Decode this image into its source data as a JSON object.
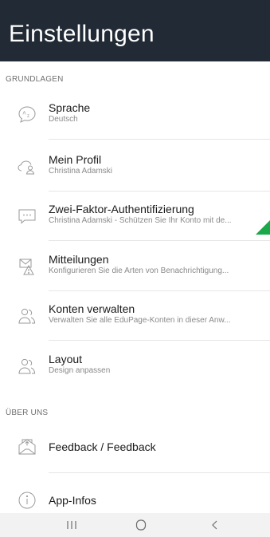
{
  "header": {
    "title": "Einstellungen"
  },
  "sections": [
    {
      "label": "GRUNDLAGEN"
    },
    {
      "label": "ÜBER UNS"
    }
  ],
  "items": [
    {
      "icon": "language-icon",
      "title": "Sprache",
      "subtitle": "Deutsch"
    },
    {
      "icon": "profile-icon",
      "title": "Mein Profil",
      "subtitle": "Christina Adamski"
    },
    {
      "icon": "two-factor-icon",
      "title": "Zwei-Faktor-Authentifizierung",
      "subtitle": "Christina Adamski - Schützen Sie Ihr Konto mit de..."
    },
    {
      "icon": "notifications-icon",
      "title": "Mitteilungen",
      "subtitle": "Konfigurieren Sie die Arten von Benachrichtigung..."
    },
    {
      "icon": "manage-accounts-icon",
      "title": "Konten verwalten",
      "subtitle": "Verwalten Sie alle EduPage-Konten in dieser Anw..."
    },
    {
      "icon": "layout-icon",
      "title": "Layout",
      "subtitle": "Design anpassen"
    },
    {
      "icon": "feedback-icon",
      "title": "Feedback / Feedback"
    },
    {
      "icon": "info-icon",
      "title": "App-Infos"
    }
  ],
  "navbar": {
    "recents": "recents-icon",
    "home": "home-icon",
    "back": "back-icon"
  },
  "colors": {
    "header_bg": "#212a35",
    "accent": "#1aa84a"
  }
}
